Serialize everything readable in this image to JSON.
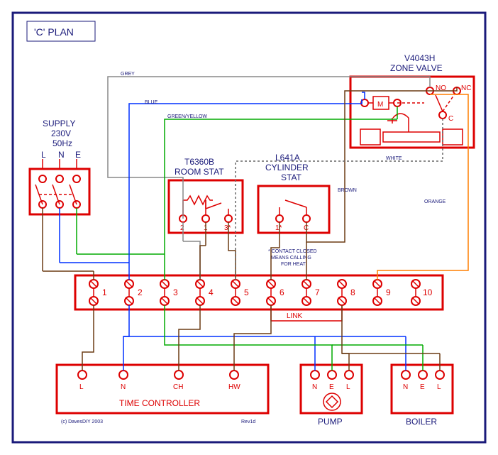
{
  "title": "'C' PLAN",
  "supply": {
    "label": "SUPPLY",
    "voltage": "230V",
    "freq": "50Hz",
    "terminals": [
      "L",
      "N",
      "E"
    ]
  },
  "zone_valve": {
    "label1": "V4043H",
    "label2": "ZONE VALVE",
    "motor": "M",
    "no": "NO",
    "nc": "NC",
    "c": "C"
  },
  "room_stat": {
    "label1": "T6360B",
    "label2": "ROOM STAT",
    "t1": "2",
    "t2": "1",
    "t3": "3*"
  },
  "cylinder_stat": {
    "label1": "L641A",
    "label2": "CYLINDER",
    "label3": "STAT",
    "t1": "1*",
    "t2": "C",
    "note1": "* CONTACT CLOSED",
    "note2": "MEANS CALLING",
    "note3": "FOR HEAT"
  },
  "strip": {
    "terminals": [
      "1",
      "2",
      "3",
      "4",
      "5",
      "6",
      "7",
      "8",
      "9",
      "10"
    ],
    "link": "LINK"
  },
  "time_controller": {
    "label": "TIME CONTROLLER",
    "t": [
      "L",
      "N",
      "CH",
      "HW"
    ]
  },
  "pump": {
    "label": "PUMP",
    "t": [
      "N",
      "E",
      "L"
    ]
  },
  "boiler": {
    "label": "BOILER",
    "t": [
      "N",
      "E",
      "L"
    ]
  },
  "wires": {
    "grey": "GREY",
    "blue": "BLUE",
    "green": "GREEN/YELLOW",
    "brown": "BROWN",
    "white": "WHITE",
    "orange": "ORANGE"
  },
  "footer": {
    "copyright": "(c) DavesDIY 2003",
    "rev": "Rev1d"
  }
}
